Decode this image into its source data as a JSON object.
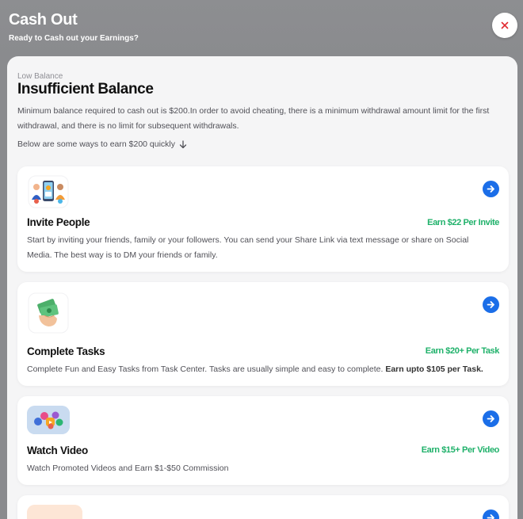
{
  "header": {
    "title": "Cash Out",
    "subtitle": "Ready to Cash out your Earnings?",
    "close_icon": "close-icon"
  },
  "balance": {
    "kicker": "Low Balance",
    "title": "Insufficient Balance",
    "description": "Minimum balance required to cash out is $200.In order to avoid cheating, there is a minimum withdrawal amount limit for the first withdrawal, and there is no limit for subsequent withdrawals.",
    "ways_text": "Below are some ways to earn $200 quickly",
    "ways_icon": "arrow-down-icon"
  },
  "cards": [
    {
      "title": "Invite People",
      "earn": "Earn $22 Per Invite",
      "description": "Start by inviting your friends, family or your followers. You can send your Share Link via text message or share on Social Media. The best way is to DM your friends or family.",
      "icon": "invite-people-icon"
    },
    {
      "title": "Complete Tasks",
      "earn": "Earn $20+ Per Task",
      "description": "Complete Fun and Easy Tasks from Task Center. Tasks are usually simple and easy to complete.",
      "description_bold": "Earn upto $105 per Task.",
      "icon": "money-hand-icon"
    },
    {
      "title": "Watch Video",
      "earn": "Earn $15+ Per Video",
      "description": "Watch Promoted Videos and Earn $1-$50 Commission",
      "icon": "social-video-icon"
    }
  ],
  "colors": {
    "header_bg": "#8a8b8e",
    "accent_blue": "#1b6ee8",
    "earn_green": "#1fb16a",
    "close_red": "#e0282e"
  }
}
